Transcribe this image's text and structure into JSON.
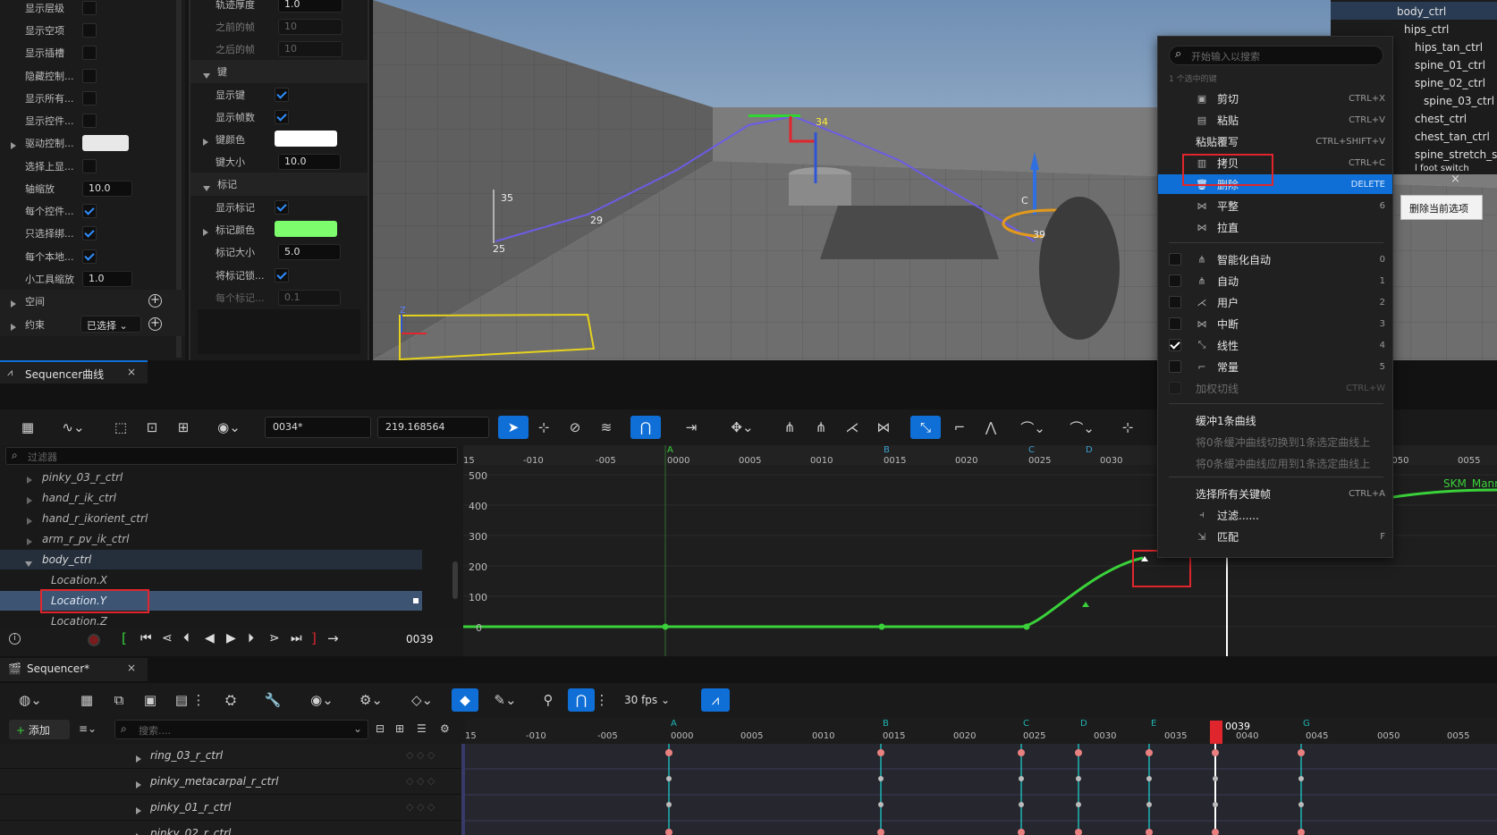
{
  "left_props": {
    "rows": [
      "显示层级",
      "显示空项",
      "显示插槽",
      "隐藏控制...",
      "显示所有...",
      "显示控件...",
      "驱动控制...",
      "选择上显...",
      "轴缩放",
      "每个控件...",
      "只选择绑...",
      "每个本地...",
      "小工具缩放"
    ],
    "axis_scale": "10.0",
    "gizmo_scale": "1.0",
    "space_label": "空间",
    "constraint_label": "约束",
    "constraint_value": "已选择"
  },
  "mid_props": {
    "trail_thickness_label": "轨迹厚度",
    "trail_thickness": "1.0",
    "frames_before_label": "之前的帧",
    "frames_before": "10",
    "frames_after_label": "之后的帧",
    "frames_after": "10",
    "keys_section": "键",
    "show_keys": "显示键",
    "show_frame_num": "显示帧数",
    "key_color": "键颜色",
    "key_size_label": "键大小",
    "key_size": "10.0",
    "marks_section": "标记",
    "show_marks": "显示标记",
    "mark_color": "标记颜色",
    "mark_size_label": "标记大小",
    "mark_size": "5.0",
    "lock_marks": "将标记锁...",
    "per_mark": "每个标记...",
    "per_mark_val": "0.1"
  },
  "viewport": {
    "labels": [
      "25",
      "29",
      "34",
      "35",
      "39",
      "C"
    ],
    "axis_z": "Z"
  },
  "outliner": {
    "items": [
      "body_ctrl",
      "hips_ctrl",
      "hips_tan_ctrl",
      "spine_01_ctrl",
      "spine_02_ctrl",
      "spine_03_ctrl",
      "chest_ctrl",
      "chest_tan_ctrl",
      "spine_stretch_s",
      "l foot switch"
    ]
  },
  "curve_editor": {
    "tab_title": "Sequencer曲线",
    "frame_field": "0034*",
    "value_field": "219.168564",
    "filter_placeholder": "过滤器",
    "tree": [
      "pinky_03_r_ctrl",
      "hand_r_ik_ctrl",
      "hand_r_ikorient_ctrl",
      "arm_r_pv_ik_ctrl",
      "body_ctrl",
      "Location.X",
      "Location.Y",
      "Location.Z"
    ],
    "ruler": [
      "15",
      "-010",
      "-005",
      "0000",
      "0005",
      "0010",
      "0015",
      "0020",
      "0025",
      "0030",
      "0050",
      "0055"
    ],
    "markers": [
      "A",
      "B",
      "C",
      "D"
    ],
    "y_axis": [
      "500",
      "400",
      "300",
      "200",
      "100",
      "0"
    ],
    "current_frame": "0039",
    "skm_label": "SKM_Mann"
  },
  "sequencer": {
    "tab_title": "Sequencer*",
    "add_label": "添加",
    "search_placeholder": "搜索....",
    "fps": "30 fps",
    "tracks": [
      "ring_03_r_ctrl",
      "pinky_metacarpal_r_ctrl",
      "pinky_01_r_ctrl",
      "pinky_02_r_ctrl"
    ],
    "ruler": [
      "15",
      "-010",
      "-005",
      "0000",
      "0005",
      "0010",
      "0015",
      "0020",
      "0025",
      "0030",
      "0035",
      "0040",
      "0045",
      "0050",
      "0055"
    ],
    "markers": [
      "A",
      "B",
      "C",
      "D",
      "E",
      "G"
    ],
    "playhead": "0039"
  },
  "context_menu": {
    "search_placeholder": "开始输入以搜索",
    "section_selected": "1 个选中的键",
    "items": [
      {
        "label": "剪切",
        "shortcut": "CTRL+X"
      },
      {
        "label": "粘贴",
        "shortcut": "CTRL+V"
      },
      {
        "label": "粘贴覆写",
        "shortcut": "CTRL+SHIFT+V"
      },
      {
        "label": "拷贝",
        "shortcut": "CTRL+C"
      },
      {
        "label": "删除",
        "shortcut": "DELETE"
      },
      {
        "label": "平整",
        "shortcut": "6"
      },
      {
        "label": "拉直",
        "shortcut": ""
      }
    ],
    "interp": [
      {
        "label": "智能化自动",
        "shortcut": "0"
      },
      {
        "label": "自动",
        "shortcut": "1"
      },
      {
        "label": "用户",
        "shortcut": "2"
      },
      {
        "label": "中断",
        "shortcut": "3"
      },
      {
        "label": "线性",
        "shortcut": "4"
      },
      {
        "label": "常量",
        "shortcut": "5"
      },
      {
        "label": "加权切线",
        "shortcut": "CTRL+W"
      }
    ],
    "buffer": "缓冲1条曲线",
    "buffer_swap": "将0条缓冲曲线切换到1条选定曲线上",
    "buffer_apply": "将0条缓冲曲线应用到1条选定曲线上",
    "select_all": "选择所有关键帧",
    "select_all_sc": "CTRL+A",
    "filter": "过滤......",
    "match": "匹配",
    "match_sc": "F"
  },
  "tooltip": "删除当前选项",
  "colors": {
    "accent": "#0f6fd6",
    "curve": "#3ad13a",
    "highlight": "#e0262c",
    "mark_color": "#7dfc6e"
  }
}
